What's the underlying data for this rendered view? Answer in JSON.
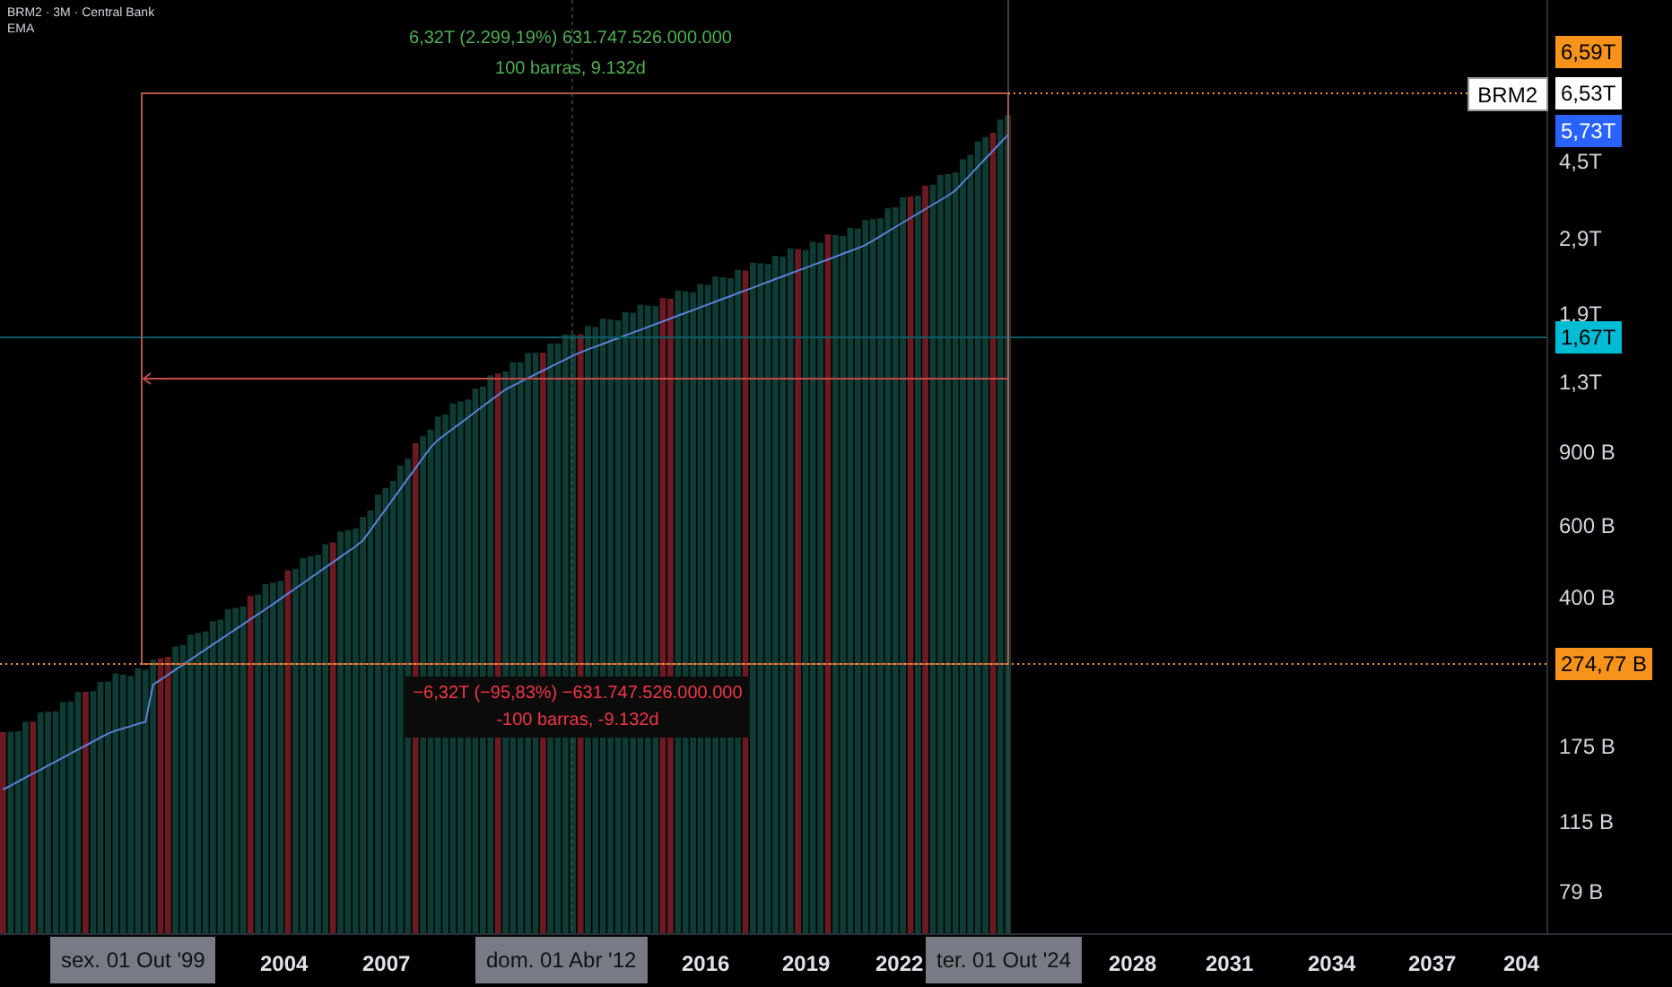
{
  "legend": {
    "title": "BRM2 · 3M · Central Bank",
    "indicator": "EMA"
  },
  "measure": {
    "up_lines": [
      "6,32T (2.299,19%) 631.747.526.000.000",
      "100 barras, 9.132d"
    ],
    "down_lines": [
      "−6,32T (−95,83%) −631.747.526.000.000",
      "-100 barras, -9.132d"
    ]
  },
  "symbol_tag": "BRM2",
  "price_axis": [
    {
      "text": "6,59T",
      "kind": "badge",
      "color": "#f7931a"
    },
    {
      "text": "6,53T",
      "kind": "badge",
      "color": "#ffffff"
    },
    {
      "text": "5,73T",
      "kind": "badge",
      "color": "#2962ff"
    },
    {
      "text": "4,5T",
      "kind": "tick"
    },
    {
      "text": "2,9T",
      "kind": "tick"
    },
    {
      "text": "1,9T",
      "kind": "tick"
    },
    {
      "text": "1,67T",
      "kind": "badge",
      "color": "#00bcd4"
    },
    {
      "text": "1,3T",
      "kind": "tick"
    },
    {
      "text": "900 B",
      "kind": "tick"
    },
    {
      "text": "600 B",
      "kind": "tick"
    },
    {
      "text": "400 B",
      "kind": "tick"
    },
    {
      "text": "274,77 B",
      "kind": "badge",
      "color": "#f7931a"
    },
    {
      "text": "175 B",
      "kind": "tick"
    },
    {
      "text": "115 B",
      "kind": "tick"
    },
    {
      "text": "79 B",
      "kind": "tick"
    }
  ],
  "time_axis": [
    {
      "text": "sex. 01 Out '99",
      "kind": "date"
    },
    {
      "text": "2004",
      "kind": "year"
    },
    {
      "text": "2007",
      "kind": "year"
    },
    {
      "text": "dom. 01 Abr '12",
      "kind": "date"
    },
    {
      "text": "2016",
      "kind": "year"
    },
    {
      "text": "2019",
      "kind": "year"
    },
    {
      "text": "2022",
      "kind": "year"
    },
    {
      "text": "ter. 01 Out '24",
      "kind": "date"
    },
    {
      "text": "2028",
      "kind": "year"
    },
    {
      "text": "2031",
      "kind": "year"
    },
    {
      "text": "2034",
      "kind": "year"
    },
    {
      "text": "2037",
      "kind": "year"
    },
    {
      "text": "204",
      "kind": "year"
    }
  ]
}
